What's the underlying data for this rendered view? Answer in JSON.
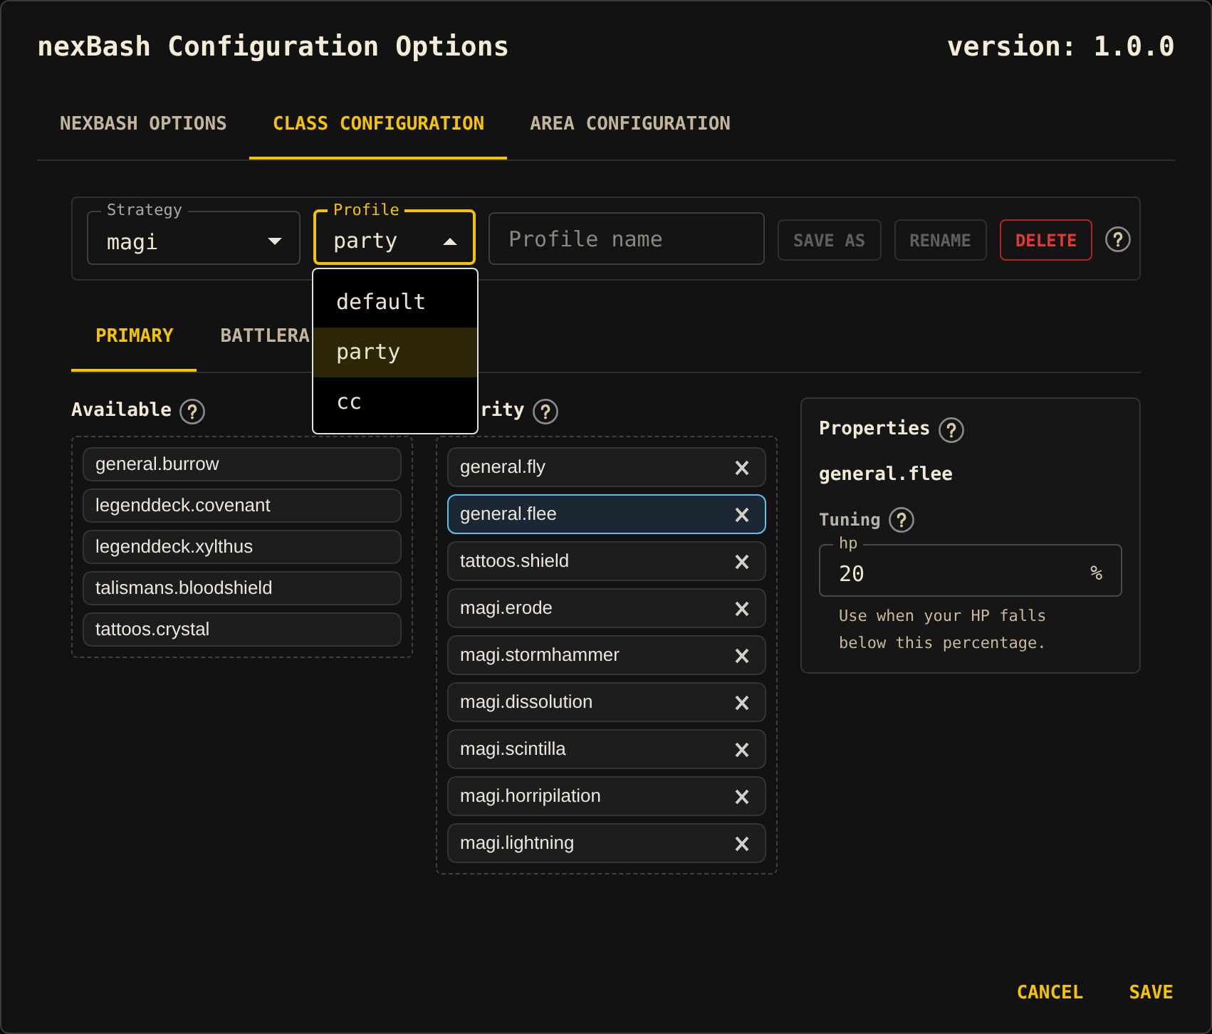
{
  "window": {
    "title": "nexBash Configuration Options",
    "version": "version: 1.0.0"
  },
  "tabs": [
    {
      "label": "NEXBASH OPTIONS",
      "selected": false
    },
    {
      "label": "CLASS CONFIGURATION",
      "selected": true
    },
    {
      "label": "AREA CONFIGURATION",
      "selected": false
    }
  ],
  "profile_bar": {
    "strategy": {
      "label": "Strategy",
      "value": "magi",
      "expanded": false
    },
    "profile": {
      "label": "Profile",
      "value": "party",
      "expanded": true,
      "options": [
        {
          "label": "default",
          "selected": false
        },
        {
          "label": "party",
          "selected": true
        },
        {
          "label": "cc",
          "selected": false
        }
      ]
    },
    "profile_name": {
      "placeholder": "Profile name"
    },
    "buttons": [
      {
        "label": "SAVE AS",
        "kind": "default",
        "disabled": true
      },
      {
        "label": "RENAME",
        "kind": "default",
        "disabled": true
      },
      {
        "label": "DELETE",
        "kind": "danger",
        "disabled": false
      }
    ]
  },
  "subtabs": [
    {
      "label": "PRIMARY",
      "selected": true
    },
    {
      "label": "BATTLERA",
      "selected": false
    }
  ],
  "available": {
    "title": "Available",
    "items": [
      {
        "label": "general.burrow",
        "selected": false
      },
      {
        "label": "legenddeck.covenant",
        "selected": false
      },
      {
        "label": "legenddeck.xylthus",
        "selected": false
      },
      {
        "label": "talismans.bloodshield",
        "selected": false
      },
      {
        "label": "tattoos.crystal",
        "selected": false
      }
    ]
  },
  "column_2": {
    "title": "rity",
    "items": [
      {
        "label": "general.fly",
        "selected": false
      },
      {
        "label": "general.flee",
        "selected": true
      },
      {
        "label": "tattoos.shield",
        "selected": false
      },
      {
        "label": "magi.erode",
        "selected": false
      },
      {
        "label": "magi.stormhammer",
        "selected": false
      },
      {
        "label": "magi.dissolution",
        "selected": false
      },
      {
        "label": "magi.scintilla",
        "selected": false
      },
      {
        "label": "magi.horripilation",
        "selected": false
      },
      {
        "label": "magi.lightning",
        "selected": false
      }
    ]
  },
  "properties": {
    "title": "Properties",
    "skill": "general.flee",
    "section": "Tuning",
    "field": {
      "label": "hp",
      "value": "20",
      "unit": "%"
    },
    "hint": "Use when your HP falls below this percentage."
  },
  "footer_buttons": [
    "CANCEL",
    "SAVE"
  ]
}
